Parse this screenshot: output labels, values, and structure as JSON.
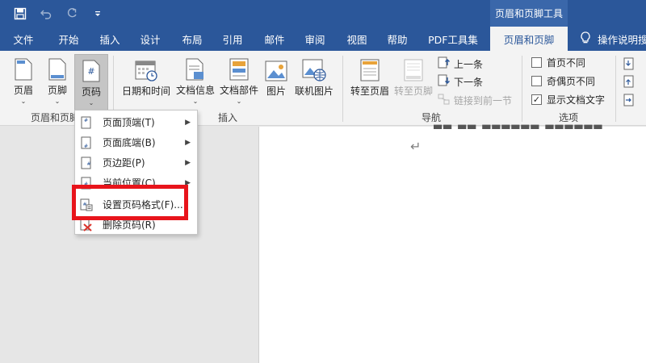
{
  "titlebar": {
    "contextual_group": "页眉和页脚工具"
  },
  "tabs": {
    "file": "文件",
    "home": "开始",
    "insert": "插入",
    "design": "设计",
    "layout": "布局",
    "references": "引用",
    "mailings": "邮件",
    "review": "审阅",
    "view": "视图",
    "help": "帮助",
    "pdf": "PDF工具集",
    "header_footer": "页眉和页脚",
    "tell_me": "操作说明搜"
  },
  "ribbon": {
    "group_header_footer": {
      "label": "页眉和页脚",
      "header": "页眉",
      "footer": "页脚",
      "page_number": "页码"
    },
    "group_insert": {
      "label": "插入",
      "date_time": "日期和时间",
      "doc_info": "文档信息",
      "quick_parts": "文档部件",
      "picture": "图片",
      "online_picture": "联机图片"
    },
    "group_nav": {
      "label": "导航",
      "goto_header": "转至页眉",
      "goto_footer": "转至页脚",
      "previous": "上一条",
      "next": "下一条",
      "link_previous": "链接到前一节"
    },
    "group_options": {
      "label": "选项",
      "diff_first": "首页不同",
      "diff_odd_even": "奇偶页不同",
      "show_doc_text": "显示文档文字",
      "show_doc_text_checked": "✓"
    }
  },
  "menu": {
    "items": [
      {
        "label": "页面顶端(T)"
      },
      {
        "label": "页面底端(B)"
      },
      {
        "label": "页边距(P)"
      },
      {
        "label": "当前位置(C)"
      },
      {
        "label": "设置页码格式(F)..."
      },
      {
        "label": "删除页码(R)"
      }
    ]
  },
  "document": {
    "paragraph_mark": "↵"
  },
  "colors": {
    "accent": "#2b579a",
    "highlight": "#e8141b"
  }
}
